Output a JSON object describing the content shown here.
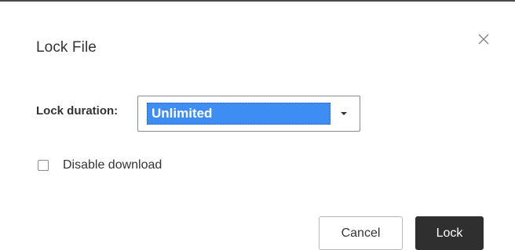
{
  "dialog": {
    "title": "Lock File",
    "close_icon": "close-icon"
  },
  "lock_duration": {
    "label": "Lock duration:",
    "selected_value": "Unlimited",
    "caret_icon": "caret-down-icon",
    "highlight_color": "#3d8df5"
  },
  "disable_download": {
    "label": "Disable download",
    "checked": false
  },
  "footer": {
    "cancel_label": "Cancel",
    "lock_label": "Lock",
    "lock_button_color": "#2f2f2f"
  }
}
